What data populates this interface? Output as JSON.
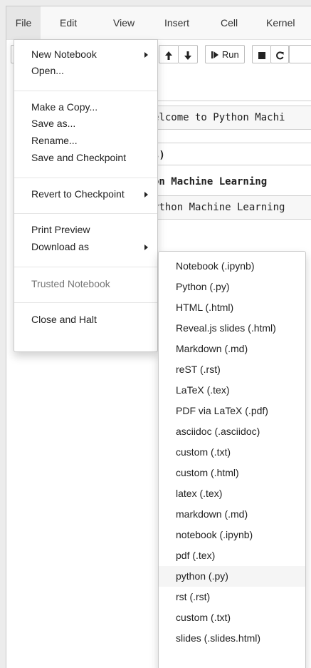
{
  "menubar": {
    "items": [
      "File",
      "Edit",
      "View",
      "Insert",
      "Cell",
      "Kernel"
    ]
  },
  "toolbar": {
    "run_label": "Run"
  },
  "notebook": {
    "lines": [
      "elcome to Python Machi",
      "s)",
      "on Machine Learning",
      "ython Machine Learning"
    ]
  },
  "file_menu": {
    "items": [
      {
        "label": "New Notebook",
        "submenu": true,
        "disabled": false
      },
      {
        "label": "Open...",
        "submenu": false,
        "disabled": false
      },
      {
        "label": "Make a Copy...",
        "submenu": false,
        "disabled": false
      },
      {
        "label": "Save as...",
        "submenu": false,
        "disabled": false
      },
      {
        "label": "Rename...",
        "submenu": false,
        "disabled": false
      },
      {
        "label": "Save and Checkpoint",
        "submenu": false,
        "disabled": false
      },
      {
        "label": "Revert to Checkpoint",
        "submenu": true,
        "disabled": false
      },
      {
        "label": "Print Preview",
        "submenu": false,
        "disabled": false
      },
      {
        "label": "Download as",
        "submenu": true,
        "disabled": false
      },
      {
        "label": "Trusted Notebook",
        "submenu": false,
        "disabled": true
      },
      {
        "label": "Close and Halt",
        "submenu": false,
        "disabled": false
      }
    ]
  },
  "download_submenu": {
    "items": [
      "Notebook (.ipynb)",
      "Python (.py)",
      "HTML (.html)",
      "Reveal.js slides (.html)",
      "Markdown (.md)",
      "reST (.rst)",
      "LaTeX (.tex)",
      "PDF via LaTeX (.pdf)",
      "asciidoc (.asciidoc)",
      "custom (.txt)",
      "custom (.html)",
      "latex (.tex)",
      "markdown (.md)",
      "notebook (.ipynb)",
      "pdf (.tex)",
      "python (.py)",
      "rst (.rst)",
      "custom (.txt)",
      "slides (.slides.html)"
    ],
    "hovered_item": "python (.py)"
  }
}
